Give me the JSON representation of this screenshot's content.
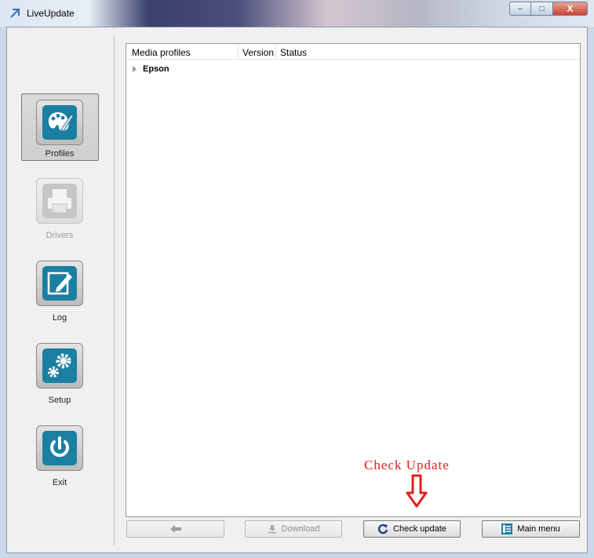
{
  "window": {
    "title": "LiveUpdate",
    "controls": {
      "minimize": "–",
      "maximize": "□",
      "close": "X"
    }
  },
  "sidebar": {
    "items": [
      {
        "label": "Profiles",
        "icon": "palette-icon",
        "state": "selected"
      },
      {
        "label": "Drivers",
        "icon": "printer-icon",
        "state": "disabled"
      },
      {
        "label": "Log",
        "icon": "edit-icon",
        "state": "normal"
      },
      {
        "label": "Setup",
        "icon": "gears-icon",
        "state": "normal"
      },
      {
        "label": "Exit",
        "icon": "power-icon",
        "state": "normal"
      }
    ]
  },
  "table": {
    "columns": [
      "Media profiles",
      "Version",
      "Status"
    ],
    "rows": [
      {
        "name": "Epson",
        "expanded": false
      }
    ]
  },
  "annotation": {
    "text": "Check Update",
    "color": "#e0201c"
  },
  "bottom_buttons": {
    "back": {
      "icon": "arrow-left-icon",
      "enabled": false
    },
    "download": {
      "label": "Download",
      "icon": "download-icon",
      "enabled": false
    },
    "check_update": {
      "label": "Check update",
      "icon": "refresh-icon",
      "enabled": true
    },
    "main_menu": {
      "label": "Main menu",
      "icon": "main-menu-icon",
      "enabled": true
    }
  },
  "colors": {
    "accent": "#2a8fb0",
    "icon_blue": "#1b7fa2"
  }
}
